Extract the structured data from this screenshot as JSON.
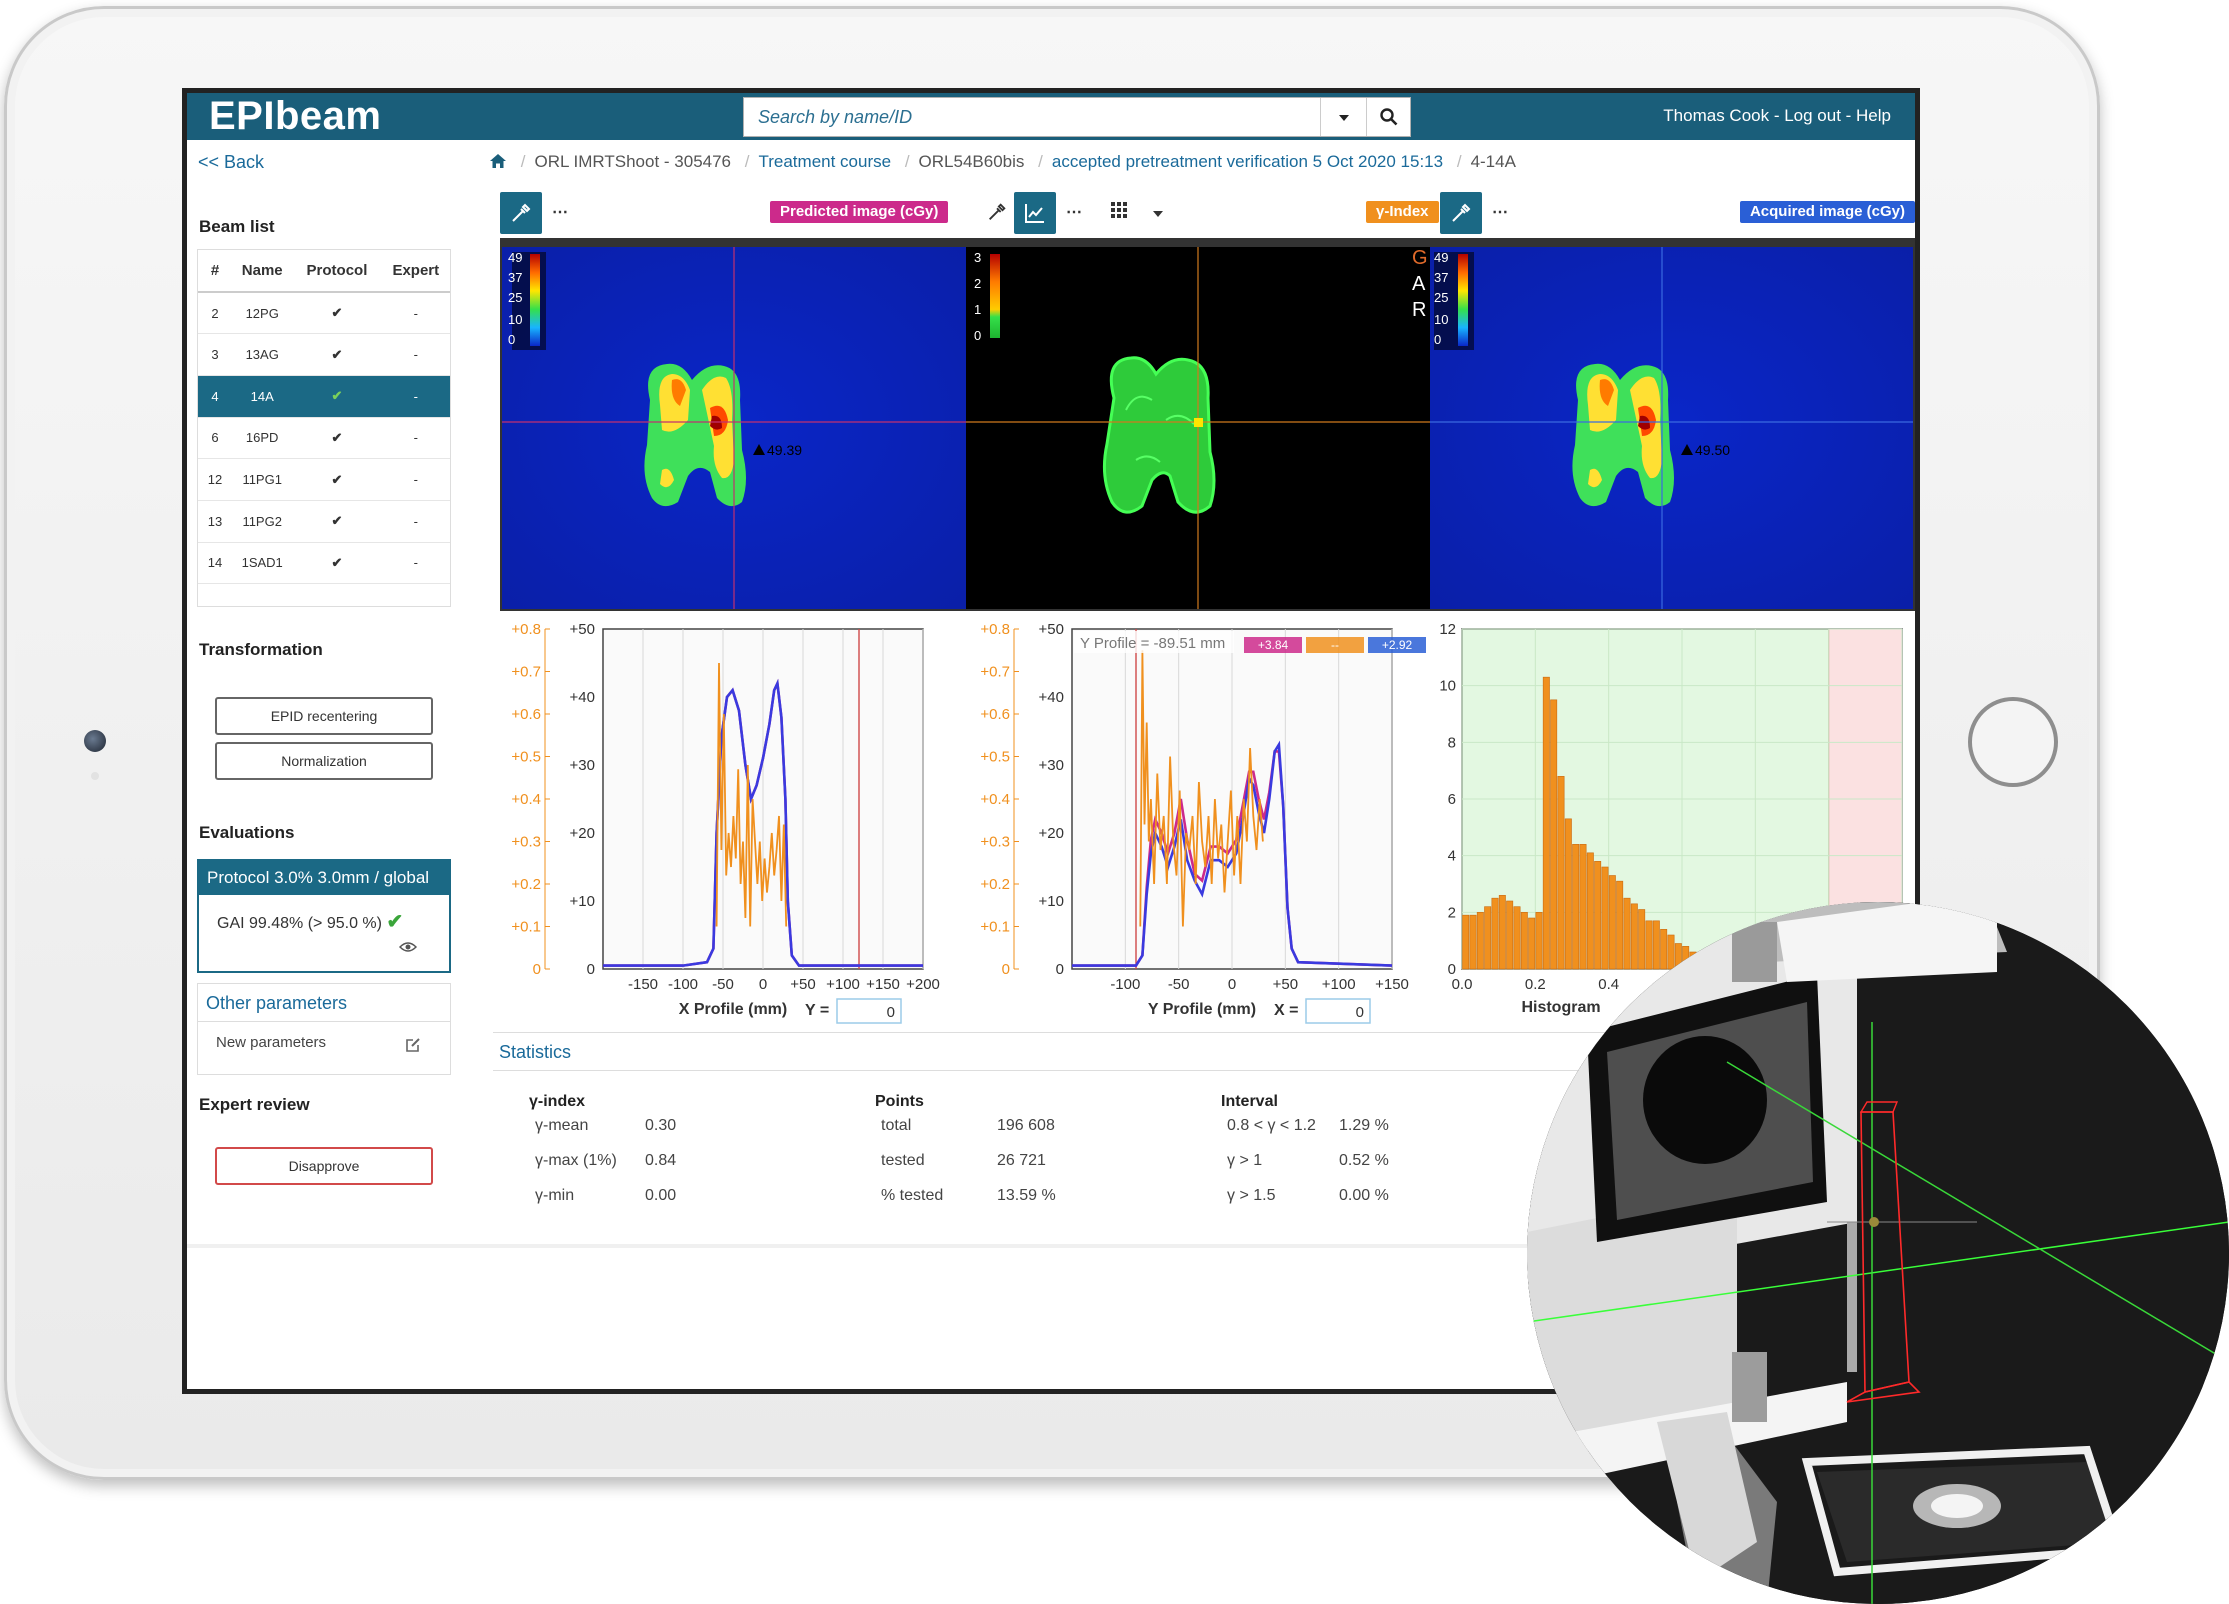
{
  "app": {
    "logo": "EPIbeam",
    "search_placeholder": "Search by name/ID",
    "user_links": "Thomas Cook - Log out - Help"
  },
  "nav": {
    "back": "<< Back",
    "breadcrumb": [
      "ORL IMRTShoot - 305476",
      "Treatment course",
      "ORL54B60bis",
      "accepted pretreatment verification 5 Oct 2020 15:13",
      "4-14A"
    ]
  },
  "sidebar": {
    "beam_list_title": "Beam list",
    "columns": [
      "#",
      "Name",
      "Protocol",
      "Expert"
    ],
    "beams": [
      {
        "num": "2",
        "name": "12PG",
        "protocol": "✔",
        "expert": "-"
      },
      {
        "num": "3",
        "name": "13AG",
        "protocol": "✔",
        "expert": "-"
      },
      {
        "num": "4",
        "name": "14A",
        "protocol": "✔",
        "expert": "-"
      },
      {
        "num": "6",
        "name": "16PD",
        "protocol": "✔",
        "expert": "-"
      },
      {
        "num": "12",
        "name": "11PG1",
        "protocol": "✔",
        "expert": "-"
      },
      {
        "num": "13",
        "name": "11PG2",
        "protocol": "✔",
        "expert": "-"
      },
      {
        "num": "14",
        "name": "1SAD1",
        "protocol": "✔",
        "expert": "-"
      }
    ],
    "selected_beam": "14A",
    "transformation_title": "Transformation",
    "epid_btn": "EPID recentering",
    "norm_btn": "Normalization",
    "evaluations_title": "Evaluations",
    "protocol_label": "Protocol 3.0% 3.0mm / global",
    "gai_text": "GAI 99.48% (> 95.0 %)",
    "gai_check": "✔",
    "other_params_title": "Other parameters",
    "new_params": "New parameters",
    "expert_review_title": "Expert review",
    "disapprove": "Disapprove"
  },
  "toolbar": {
    "dash": "⋯",
    "predicted_badge": "Predicted image (cGy)",
    "gamma_badge": "γ-Index",
    "acquired_badge": "Acquired image (cGy)",
    "colors": {
      "predicted": "#cc2a8b",
      "gamma": "#f0901e",
      "acquired": "#2a5fd6"
    }
  },
  "images": {
    "predicted_scale": [
      "49",
      "37",
      "25",
      "10",
      "0"
    ],
    "gamma_scale": [
      "3",
      "2",
      "1",
      "0"
    ],
    "acquired_scale": [
      "49",
      "37",
      "25",
      "10",
      "0"
    ],
    "gar_letters": [
      "G",
      "A",
      "R"
    ],
    "predicted_marker": "49.39",
    "acquired_marker": "49.50"
  },
  "chart_data": [
    {
      "type": "line",
      "xlabel": "X Profile (mm)",
      "x_ticks": [
        "-150",
        "-100",
        "-50",
        "0",
        "+50",
        "+100",
        "+150",
        "+200"
      ],
      "x_range": [
        -200,
        200
      ],
      "y_right_ticks": [
        "0",
        "+10",
        "+20",
        "+30",
        "+40",
        "+50"
      ],
      "y_right_range": [
        0,
        50
      ],
      "y_left_ticks": [
        "0",
        "+0.1",
        "+0.2",
        "+0.3",
        "+0.4",
        "+0.5",
        "+0.6",
        "+0.7",
        "+0.8"
      ],
      "y_left_range": [
        0,
        0.8
      ],
      "input_label": "Y =",
      "input_value": "0",
      "series": [
        {
          "color": "#cc2a8b",
          "points": [
            [
              -200,
              0.5
            ],
            [
              -100,
              0.5
            ],
            [
              -70,
              1
            ],
            [
              -62,
              3
            ],
            [
              -58,
              20
            ],
            [
              -52,
              34
            ],
            [
              -45,
              40
            ],
            [
              -38,
              41
            ],
            [
              -30,
              38
            ],
            [
              -22,
              30
            ],
            [
              -15,
              25
            ],
            [
              -8,
              27
            ],
            [
              0,
              31
            ],
            [
              8,
              36
            ],
            [
              14,
              41
            ],
            [
              18,
              42
            ],
            [
              23,
              37
            ],
            [
              28,
              25
            ],
            [
              31,
              10
            ],
            [
              36,
              2
            ],
            [
              45,
              0.5
            ],
            [
              200,
              0.5
            ]
          ]
        },
        {
          "color": "#3a3adf",
          "points": [
            [
              -200,
              0.5
            ],
            [
              -100,
              0.5
            ],
            [
              -70,
              1
            ],
            [
              -62,
              3
            ],
            [
              -58,
              20
            ],
            [
              -52,
              34
            ],
            [
              -45,
              40
            ],
            [
              -38,
              41
            ],
            [
              -30,
              38
            ],
            [
              -22,
              30
            ],
            [
              -15,
              25
            ],
            [
              -8,
              27
            ],
            [
              0,
              31
            ],
            [
              8,
              36
            ],
            [
              14,
              41
            ],
            [
              18,
              42
            ],
            [
              23,
              37
            ],
            [
              28,
              25
            ],
            [
              31,
              10
            ],
            [
              36,
              2
            ],
            [
              45,
              0.5
            ],
            [
              200,
              0.5
            ]
          ]
        },
        {
          "color": "#f0901e",
          "axis": "left",
          "points": [
            [
              -58,
              0.1
            ],
            [
              -55,
              0.72
            ],
            [
              -52,
              0.28
            ],
            [
              -49,
              0.6
            ],
            [
              -46,
              0.22
            ],
            [
              -43,
              0.32
            ],
            [
              -40,
              0.24
            ],
            [
              -37,
              0.36
            ],
            [
              -34,
              0.26
            ],
            [
              -31,
              0.47
            ],
            [
              -28,
              0.2
            ],
            [
              -25,
              0.3
            ],
            [
              -22,
              0.12
            ],
            [
              -19,
              0.48
            ],
            [
              -16,
              0.1
            ],
            [
              -13,
              0.4
            ],
            [
              -10,
              0.3
            ],
            [
              -7,
              0.2
            ],
            [
              -4,
              0.3
            ],
            [
              -1,
              0.16
            ],
            [
              2,
              0.26
            ],
            [
              5,
              0.18
            ],
            [
              8,
              0.24
            ],
            [
              11,
              0.32
            ],
            [
              14,
              0.22
            ],
            [
              17,
              0.28
            ],
            [
              20,
              0.36
            ],
            [
              23,
              0.16
            ],
            [
              26,
              0.34
            ],
            [
              29,
              0.1
            ]
          ]
        }
      ]
    },
    {
      "type": "line",
      "title": "Y Profile = -89.51 mm",
      "legend_values": [
        "+3.84",
        "--",
        "+2.92"
      ],
      "xlabel": "Y Profile (mm)",
      "x_ticks": [
        "-100",
        "-50",
        "0",
        "+50",
        "+100",
        "+150"
      ],
      "x_range": [
        -150,
        150
      ],
      "y_right_ticks": [
        "0",
        "+10",
        "+20",
        "+30",
        "+40",
        "+50"
      ],
      "y_right_range": [
        0,
        50
      ],
      "y_left_ticks": [
        "0",
        "+0.1",
        "+0.2",
        "+0.3",
        "+0.4",
        "+0.5",
        "+0.6",
        "+0.7",
        "+0.8"
      ],
      "y_left_range": [
        0,
        0.8
      ],
      "input_label": "X =",
      "input_value": "0",
      "series": [
        {
          "color": "#cc2a8b",
          "points": [
            [
              -150,
              0.5
            ],
            [
              -90,
              0.5
            ],
            [
              -84,
              2
            ],
            [
              -80,
              12
            ],
            [
              -76,
              19
            ],
            [
              -72,
              22
            ],
            [
              -66,
              20
            ],
            [
              -60,
              17
            ],
            [
              -54,
              20
            ],
            [
              -48,
              25
            ],
            [
              -42,
              19
            ],
            [
              -35,
              14
            ],
            [
              -28,
              13
            ],
            [
              -20,
              18
            ],
            [
              -12,
              18
            ],
            [
              -4,
              17
            ],
            [
              4,
              19
            ],
            [
              10,
              24
            ],
            [
              16,
              29
            ],
            [
              20,
              29
            ],
            [
              25,
              25
            ],
            [
              30,
              22
            ],
            [
              35,
              26
            ],
            [
              40,
              32
            ],
            [
              44,
              32
            ],
            [
              48,
              24
            ],
            [
              52,
              9
            ],
            [
              56,
              3
            ],
            [
              62,
              1
            ],
            [
              150,
              0.5
            ]
          ]
        },
        {
          "color": "#3a3adf",
          "points": [
            [
              -150,
              0.5
            ],
            [
              -90,
              0.5
            ],
            [
              -84,
              2
            ],
            [
              -80,
              11
            ],
            [
              -76,
              17
            ],
            [
              -72,
              20
            ],
            [
              -66,
              18
            ],
            [
              -60,
              15
            ],
            [
              -54,
              18
            ],
            [
              -48,
              22
            ],
            [
              -42,
              16
            ],
            [
              -35,
              13
            ],
            [
              -28,
              11
            ],
            [
              -20,
              16
            ],
            [
              -12,
              16
            ],
            [
              -4,
              15
            ],
            [
              4,
              17
            ],
            [
              10,
              22
            ],
            [
              16,
              28
            ],
            [
              20,
              27
            ],
            [
              25,
              23
            ],
            [
              30,
              20
            ],
            [
              35,
              25
            ],
            [
              40,
              32
            ],
            [
              44,
              33
            ],
            [
              48,
              24
            ],
            [
              52,
              9
            ],
            [
              56,
              3
            ],
            [
              62,
              1
            ],
            [
              150,
              0.5
            ]
          ]
        },
        {
          "color": "#f0901e",
          "axis": "left",
          "points": [
            [
              -86,
              0.1
            ],
            [
              -84,
              0.75
            ],
            [
              -82,
              0.34
            ],
            [
              -80,
              0.58
            ],
            [
              -78,
              0.3
            ],
            [
              -76,
              0.4
            ],
            [
              -73,
              0.2
            ],
            [
              -70,
              0.46
            ],
            [
              -67,
              0.28
            ],
            [
              -64,
              0.36
            ],
            [
              -61,
              0.2
            ],
            [
              -58,
              0.5
            ],
            [
              -55,
              0.3
            ],
            [
              -52,
              0.22
            ],
            [
              -49,
              0.42
            ],
            [
              -46,
              0.1
            ],
            [
              -43,
              0.32
            ],
            [
              -40,
              0.28
            ],
            [
              -37,
              0.36
            ],
            [
              -34,
              0.2
            ],
            [
              -31,
              0.44
            ],
            [
              -28,
              0.3
            ],
            [
              -25,
              0.24
            ],
            [
              -22,
              0.36
            ],
            [
              -19,
              0.2
            ],
            [
              -16,
              0.4
            ],
            [
              -13,
              0.26
            ],
            [
              -10,
              0.34
            ],
            [
              -7,
              0.18
            ],
            [
              -4,
              0.3
            ],
            [
              -1,
              0.42
            ],
            [
              2,
              0.22
            ],
            [
              5,
              0.36
            ],
            [
              8,
              0.2
            ],
            [
              11,
              0.4
            ],
            [
              14,
              0.3
            ],
            [
              17,
              0.52
            ],
            [
              20,
              0.36
            ],
            [
              23,
              0.28
            ],
            [
              26,
              0.4
            ],
            [
              29,
              0.3
            ]
          ]
        }
      ]
    },
    {
      "type": "bar",
      "xlabel": "Histogram",
      "x_ticks": [
        "0.0",
        "0.2",
        "0.4"
      ],
      "x_range": [
        0,
        1.2
      ],
      "y_ticks": [
        "0",
        "2",
        "4",
        "6",
        "8",
        "10",
        "12"
      ],
      "y_range": [
        0,
        12
      ],
      "bar_color": "#f0901e",
      "bin_width": 0.02,
      "values": [
        1.9,
        1.9,
        2.0,
        2.2,
        2.5,
        2.6,
        2.4,
        2.2,
        2.0,
        1.8,
        2.0,
        10.3,
        9.5,
        6.8,
        5.3,
        4.4,
        4.4,
        4.1,
        3.8,
        3.6,
        3.3,
        3.1,
        2.5,
        2.3,
        2.1,
        1.7,
        1.7,
        1.4,
        1.2,
        0.9,
        0.8,
        0.6,
        0.4,
        0.3,
        0.2,
        0.1
      ]
    }
  ],
  "statistics": {
    "title": "Statistics",
    "gamma": {
      "header": "γ-index",
      "rows": [
        [
          "γ-mean",
          "0.30"
        ],
        [
          "γ-max (1%)",
          "0.84"
        ],
        [
          "γ-min",
          "0.00"
        ]
      ]
    },
    "points": {
      "header": "Points",
      "rows": [
        [
          "total",
          "196 608"
        ],
        [
          "tested",
          "26 721"
        ],
        [
          "% tested",
          "13.59 %"
        ]
      ]
    },
    "interval": {
      "header": "Interval",
      "rows": [
        [
          "0.8 < γ < 1.2",
          "1.29 %"
        ],
        [
          "γ > 1",
          "0.52 %"
        ],
        [
          "γ > 1.5",
          "0.00 %"
        ]
      ]
    }
  }
}
